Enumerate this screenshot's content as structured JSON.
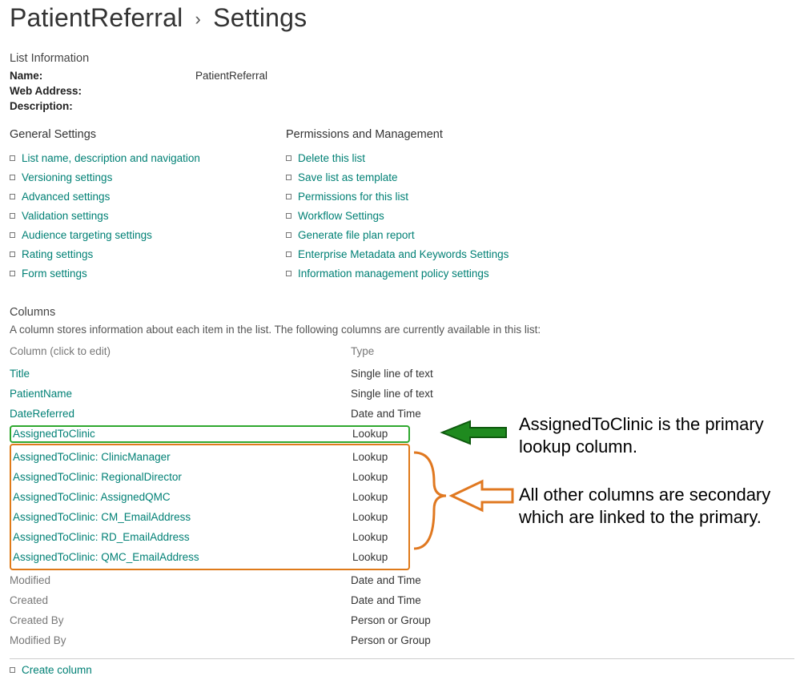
{
  "breadcrumb": {
    "list_name": "PatientReferral",
    "settings_label": "Settings"
  },
  "list_info": {
    "heading": "List Information",
    "name_label": "Name:",
    "name_value": "PatientReferral",
    "web_address_label": "Web Address:",
    "web_address_value": "",
    "description_label": "Description:",
    "description_value": ""
  },
  "general": {
    "heading": "General Settings",
    "items": [
      "List name, description and navigation",
      "Versioning settings",
      "Advanced settings",
      "Validation settings",
      "Audience targeting settings",
      "Rating settings",
      "Form settings"
    ]
  },
  "perms": {
    "heading": "Permissions and Management",
    "items": [
      "Delete this list",
      "Save list as template",
      "Permissions for this list",
      "Workflow Settings",
      "Generate file plan report",
      "Enterprise Metadata and Keywords Settings",
      "Information management policy settings"
    ]
  },
  "columns": {
    "heading": "Columns",
    "description": "A column stores information about each item in the list. The following columns are currently available in this list:",
    "header_name": "Column (click to edit)",
    "header_type": "Type",
    "rows": [
      {
        "name": "Title",
        "type": "Single line of text",
        "link": true
      },
      {
        "name": "PatientName",
        "type": "Single line of text",
        "link": true
      },
      {
        "name": "DateReferred",
        "type": "Date and Time",
        "link": true
      },
      {
        "name": "AssignedToClinic",
        "type": "Lookup",
        "link": true
      },
      {
        "name": "AssignedToClinic: ClinicManager",
        "type": "Lookup",
        "link": true
      },
      {
        "name": "AssignedToClinic: RegionalDirector",
        "type": "Lookup",
        "link": true
      },
      {
        "name": "AssignedToClinic: AssignedQMC",
        "type": "Lookup",
        "link": true
      },
      {
        "name": "AssignedToClinic: CM_EmailAddress",
        "type": "Lookup",
        "link": true
      },
      {
        "name": "AssignedToClinic: RD_EmailAddress",
        "type": "Lookup",
        "link": true
      },
      {
        "name": "AssignedToClinic: QMC_EmailAddress",
        "type": "Lookup",
        "link": true
      },
      {
        "name": "Modified",
        "type": "Date and Time",
        "link": false
      },
      {
        "name": "Created",
        "type": "Date and Time",
        "link": false
      },
      {
        "name": "Created By",
        "type": "Person or Group",
        "link": false
      },
      {
        "name": "Modified By",
        "type": "Person or Group",
        "link": false
      }
    ],
    "create_label": "Create column"
  },
  "annotations": {
    "primary_text": "AssignedToClinic is the primary lookup column.",
    "secondary_text": "All other columns are secondary which are linked to the primary."
  }
}
